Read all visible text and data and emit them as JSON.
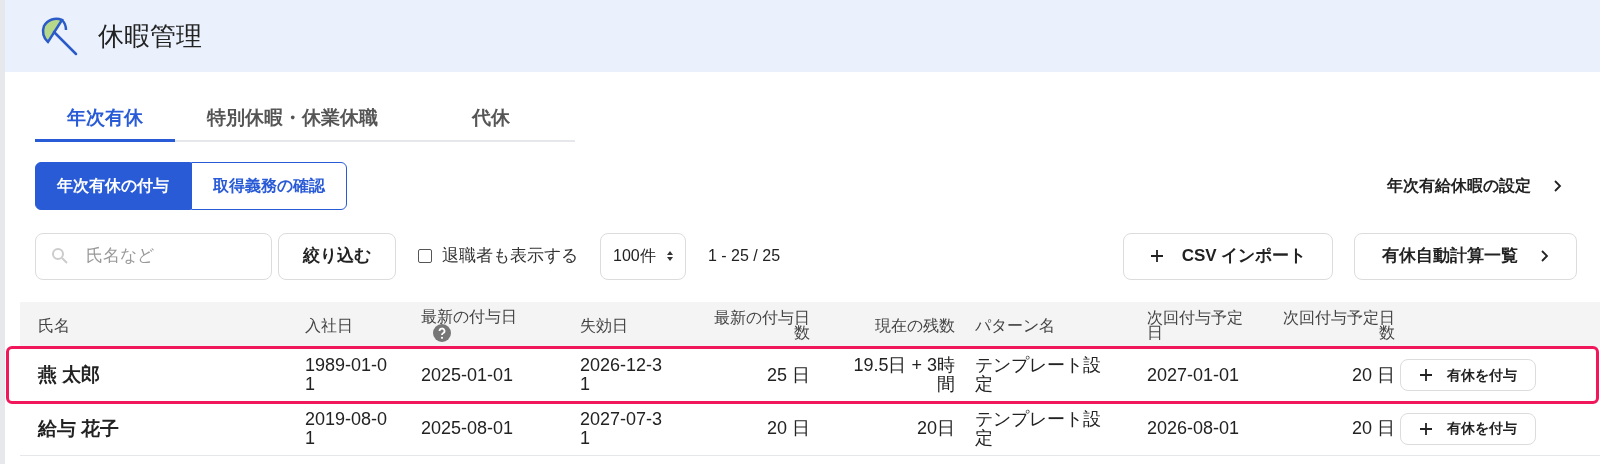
{
  "header": {
    "title": "休暇管理"
  },
  "tabs": [
    {
      "label": "年次有休",
      "selected": true
    },
    {
      "label": "特別休暇・休業休職",
      "selected": false
    },
    {
      "label": "代休",
      "selected": false
    }
  ],
  "segments": [
    {
      "label": "年次有休の付与",
      "selected": true
    },
    {
      "label": "取得義務の確認",
      "selected": false
    }
  ],
  "settings_link": "年次有給休暇の設定",
  "toolbar": {
    "search": {
      "placeholder": "氏名など"
    },
    "filter_button": "絞り込む",
    "show_retired": {
      "label": "退職者も表示する",
      "checked": false
    },
    "page_size": "100件",
    "count": "1 - 25 / 25",
    "csv_button": "CSV インポート",
    "auto_calc_button": "有休自動計算一覧"
  },
  "table": {
    "columns": [
      "氏名",
      "入社日",
      "最新の付与日",
      "失効日",
      "最新の付与日数",
      "現在の残数",
      "パターン名",
      "次回付与予定日",
      "次回付与予定日数"
    ],
    "rows": [
      {
        "highlighted": true,
        "cells": [
          "燕 太郎",
          "1989-01-01",
          "2025-01-01",
          "2026-12-31",
          "25 日",
          "19.5日 + 3時間",
          "テンプレート設定",
          "2027-01-01",
          "20 日"
        ],
        "action": "有休を付与"
      },
      {
        "highlighted": false,
        "cells": [
          "給与 花子",
          "2019-08-01",
          "2025-08-01",
          "2027-07-31",
          "20 日",
          "20日",
          "テンプレート設定",
          "2026-08-01",
          "20 日"
        ],
        "action": "有休を付与"
      }
    ]
  }
}
